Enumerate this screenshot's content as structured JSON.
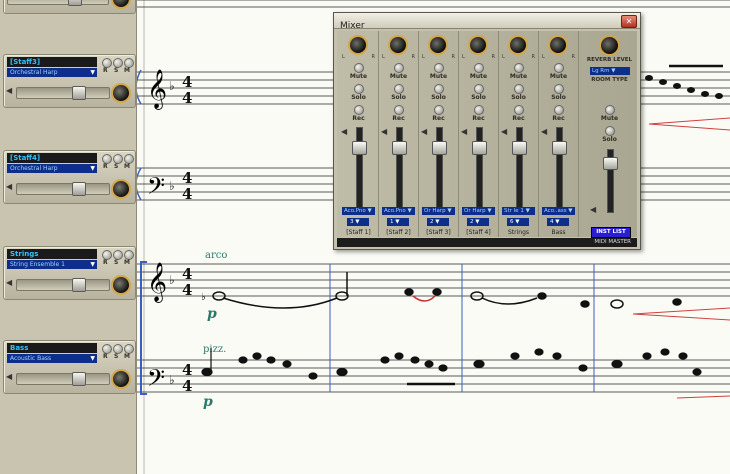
{
  "staff_panel": {
    "strips": [
      {
        "name": "[Staff3]",
        "instrument": "Orchestral Harp"
      },
      {
        "name": "[Staff4]",
        "instrument": "Orchestral Harp"
      },
      {
        "name": "Strings",
        "instrument": "String Ensemble 1"
      },
      {
        "name": "Bass",
        "instrument": "Acoustic Bass"
      }
    ],
    "mute_letter": "M",
    "solo_letter": "S",
    "rec_letter": "R",
    "dropdown_glyph": "▼"
  },
  "score": {
    "time_signature_top": "4",
    "time_signature_bottom": "4",
    "annotations": {
      "arco": "arco",
      "pizz": "pizz.",
      "dyn_strings": "p",
      "dyn_bass": "p"
    }
  },
  "mixer": {
    "title": "Mixer",
    "close_glyph": "✕",
    "knob_left": "L",
    "knob_right": "R",
    "mute_label": "Mute",
    "solo_label": "Solo",
    "rec_label": "Rec",
    "channels": [
      {
        "instrument": "Aco.Pno ▼",
        "channel": "3 ▼",
        "name": "[Staff 1]"
      },
      {
        "instrument": "Aco.Pno ▼",
        "channel": "1 ▼",
        "name": "[Staff 2]"
      },
      {
        "instrument": "Or Harp ▼",
        "channel": "2 ▼",
        "name": "[Staff 3]"
      },
      {
        "instrument": "Or Harp ▼",
        "channel": "2 ▼",
        "name": "[Staff 4]"
      },
      {
        "instrument": "Str le 1 ▼",
        "channel": "6 ▼",
        "name": "Strings"
      },
      {
        "instrument": "Aco..ass ▼",
        "channel": "4 ▼",
        "name": "Bass"
      }
    ],
    "master": {
      "reverb_label": "REVERB LEVEL",
      "room_select": "Lg Rm ▼",
      "room_type_label": "ROOM TYPE",
      "mute_label": "Mute",
      "solo_label": "Solo",
      "inst_list_label": "INST LIST"
    },
    "footer": "MIDI MASTER"
  }
}
